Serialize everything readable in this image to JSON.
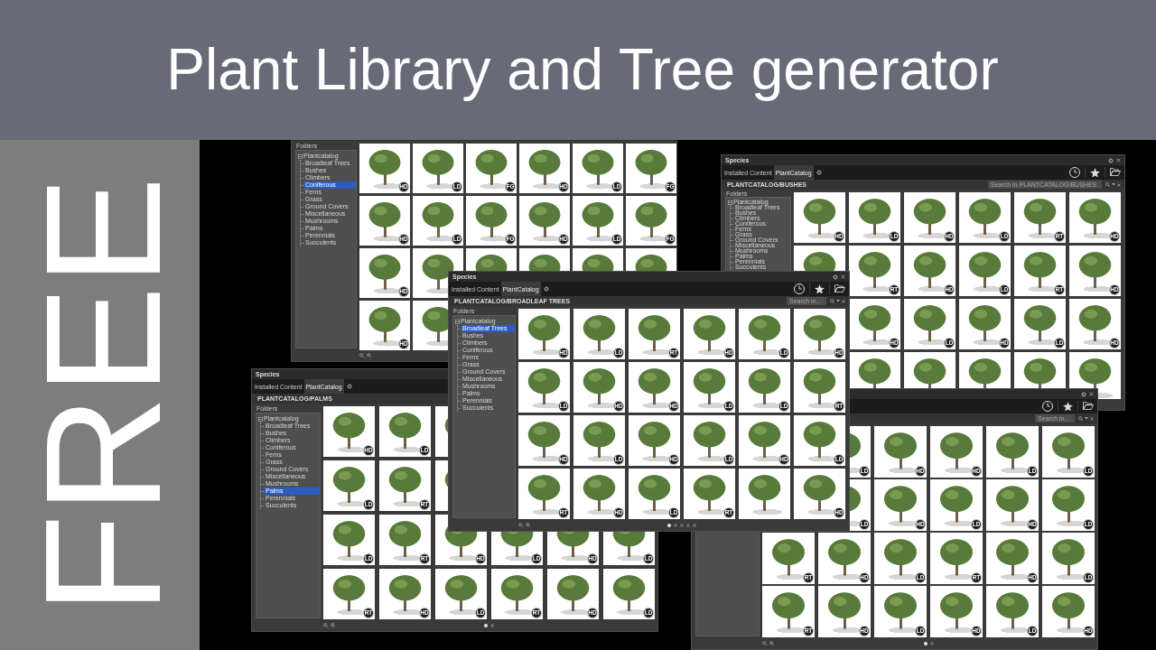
{
  "banner": {
    "title": "Plant Library and Tree generator"
  },
  "side_panel": {
    "text": "FREE"
  },
  "windows": [
    {
      "folders_label": "Folders",
      "folders": [
        {
          "label": "Plantcatalog",
          "expanded": true,
          "selected": false,
          "children": [
            {
              "label": "Broadleaf Trees",
              "selected": false
            },
            {
              "label": "Bushes",
              "selected": false
            },
            {
              "label": "Climbers",
              "selected": false
            },
            {
              "label": "Coniferous",
              "selected": true
            },
            {
              "label": "Ferns",
              "selected": false
            },
            {
              "label": "Grass",
              "selected": false
            },
            {
              "label": "Ground Covers",
              "selected": false
            },
            {
              "label": "Miscellaneous",
              "selected": false
            },
            {
              "label": "Mushrooms",
              "selected": false
            },
            {
              "label": "Palms",
              "selected": false
            },
            {
              "label": "Perennials",
              "selected": false
            },
            {
              "label": "Succulents",
              "selected": false
            }
          ]
        }
      ],
      "rows": [
        {
          "tiles": [
            {
              "selected": false,
              "badge": "HD"
            },
            {
              "selected": false,
              "badge": "LD"
            },
            {
              "selected": false,
              "badge": "FG"
            },
            {
              "selected": false,
              "badge": "HD"
            },
            {
              "selected": false,
              "badge": "LD"
            },
            {
              "selected": false,
              "badge": "FG"
            }
          ]
        },
        {
          "tiles": [
            {
              "selected": false,
              "badge": "HD"
            },
            {
              "selected": false,
              "badge": "LD"
            },
            {
              "selected": false,
              "badge": "FG"
            },
            {
              "selected": false,
              "badge": "HD"
            },
            {
              "selected": false,
              "badge": "LD"
            },
            {
              "selected": false,
              "badge": "FG"
            }
          ]
        },
        {
          "tiles": [
            {
              "selected": false,
              "badge": "HD"
            },
            {
              "selected": false
            },
            {
              "selected": false
            },
            {
              "selected": false
            },
            {
              "selected": false
            },
            {
              "selected": false
            }
          ]
        },
        {
          "tiles": [
            {
              "selected": false,
              "badge": "HD"
            },
            {
              "selected": false
            }
          ]
        }
      ],
      "zoom_buttons": true
    },
    {
      "title": "Species",
      "window_buttons": true,
      "tabs": [
        {
          "label": "Installed Content",
          "selected": false
        },
        {
          "label": "PlantCatalog",
          "selected": true
        }
      ],
      "library_tools": true,
      "path": "PLANTCATALOG/BUSHES",
      "search": {
        "placeholder": "Search in PLANTCATALOG/BUSHES"
      },
      "folders_label": "Folders",
      "folders": [
        {
          "label": "Plantcatalog",
          "expanded": true,
          "selected": false,
          "children": [
            {
              "label": "Broadleaf Trees",
              "selected": false
            },
            {
              "label": "Bushes",
              "selected": false
            },
            {
              "label": "Climbers",
              "selected": false
            },
            {
              "label": "Coniferous",
              "selected": false
            },
            {
              "label": "Ferns",
              "selected": false
            },
            {
              "label": "Grass",
              "selected": false
            },
            {
              "label": "Ground Covers",
              "selected": false
            },
            {
              "label": "Miscellaneous",
              "selected": false
            },
            {
              "label": "Mushrooms",
              "selected": false
            },
            {
              "label": "Palms",
              "selected": false
            },
            {
              "label": "Perennials",
              "selected": false
            },
            {
              "label": "Succulents",
              "selected": false
            }
          ]
        }
      ],
      "rows": [
        {
          "tiles": [
            {
              "selected": false,
              "badge": "HD"
            },
            {
              "selected": false,
              "badge": "LD"
            },
            {
              "selected": false,
              "badge": "HD"
            },
            {
              "selected": false,
              "badge": "LD"
            },
            {
              "selected": false,
              "badge": "RT"
            },
            {
              "selected": false,
              "badge": "HD"
            }
          ]
        },
        {
          "tiles": [
            {
              "selected": false
            },
            {
              "selected": false,
              "badge": "RT"
            },
            {
              "selected": false,
              "badge": "HD"
            },
            {
              "selected": false,
              "badge": "LD"
            },
            {
              "selected": false,
              "badge": "RT"
            },
            {
              "selected": false,
              "badge": "HD"
            }
          ]
        },
        {
          "tiles": [
            {
              "selected": false,
              "badge": "HD"
            },
            {
              "selected": false,
              "badge": "LD"
            },
            {
              "selected": false,
              "badge": "HD"
            },
            {
              "selected": false,
              "badge": "LD"
            },
            {
              "selected": false,
              "badge": "HD"
            }
          ]
        },
        {
          "tiles": [
            {
              "selected": false
            },
            {
              "selected": false
            },
            {
              "selected": false
            },
            {
              "selected": false
            },
            {
              "selected": false
            }
          ]
        }
      ]
    },
    {
      "title": "Species",
      "window_buttons": true,
      "tabs": [
        {
          "label": "Installed Content",
          "selected": false
        },
        {
          "label": "PlantCatalog",
          "selected": true
        }
      ],
      "library_tools": true,
      "path": "PLANTCATALOG/BROADLEAF TREES",
      "search": {
        "placeholder": "Search in..."
      },
      "folders_label": "Folders",
      "folders": [
        {
          "label": "Plantcatalog",
          "expanded": true,
          "selected": false,
          "children": [
            {
              "label": "Broadleaf Trees",
              "selected": true
            },
            {
              "label": "Bushes",
              "selected": false
            },
            {
              "label": "Climbers",
              "selected": false
            },
            {
              "label": "Coniferous",
              "selected": false
            },
            {
              "label": "Ferns",
              "selected": false
            },
            {
              "label": "Grass",
              "selected": false
            },
            {
              "label": "Ground Covers",
              "selected": false
            },
            {
              "label": "Miscellaneous",
              "selected": false
            },
            {
              "label": "Mushrooms",
              "selected": false
            },
            {
              "label": "Palms",
              "selected": false
            },
            {
              "label": "Perennials",
              "selected": false
            },
            {
              "label": "Succulents",
              "selected": false
            }
          ]
        }
      ],
      "rows": [
        {
          "tiles": [
            {
              "selected": false,
              "badge": "HD"
            },
            {
              "selected": false,
              "badge": "LD"
            },
            {
              "selected": false,
              "badge": "RT"
            },
            {
              "selected": false,
              "badge": "HD"
            },
            {
              "selected": false,
              "badge": "LD"
            },
            {
              "selected": false,
              "badge": "HD"
            }
          ]
        },
        {
          "tiles": [
            {
              "selected": false,
              "badge": "LD"
            },
            {
              "selected": false,
              "badge": "HD"
            },
            {
              "selected": false,
              "badge": "HD"
            },
            {
              "selected": false,
              "badge": "LD"
            },
            {
              "selected": false,
              "badge": "LD"
            },
            {
              "selected": false,
              "badge": "RT"
            }
          ]
        },
        {
          "tiles": [
            {
              "selected": false,
              "badge": "HD"
            },
            {
              "selected": false,
              "badge": "LD"
            },
            {
              "selected": false,
              "badge": "HD"
            },
            {
              "selected": false,
              "badge": "LD"
            },
            {
              "selected": false,
              "badge": "HD"
            },
            {
              "selected": false,
              "badge": "LD"
            }
          ]
        },
        {
          "tiles": [
            {
              "selected": false,
              "badge": "RT"
            },
            {
              "selected": false,
              "badge": "HD"
            },
            {
              "selected": false,
              "badge": "LD"
            },
            {
              "selected": false,
              "badge": "RT"
            },
            {
              "selected": false
            },
            {
              "selected": false,
              "badge": "HD"
            }
          ]
        }
      ],
      "zoom_buttons": true,
      "pages": [
        {
          "selected": true
        },
        {
          "selected": false
        },
        {
          "selected": false
        },
        {
          "selected": false
        },
        {
          "selected": false
        }
      ]
    },
    {
      "title": "Species",
      "tabs": [
        {
          "label": "Installed Content",
          "selected": false
        },
        {
          "label": "PlantCatalog",
          "selected": true
        }
      ],
      "path": "PLANTCATALOG/PALMS",
      "folders_label": "Folders",
      "folders": [
        {
          "label": "Plantcatalog",
          "expanded": true,
          "selected": false,
          "children": [
            {
              "label": "Broadleaf Trees",
              "selected": false
            },
            {
              "label": "Bushes",
              "selected": false
            },
            {
              "label": "Climbers",
              "selected": false
            },
            {
              "label": "Coniferous",
              "selected": false
            },
            {
              "label": "Ferns",
              "selected": false
            },
            {
              "label": "Grass",
              "selected": false
            },
            {
              "label": "Ground Covers",
              "selected": false
            },
            {
              "label": "Miscellaneous",
              "selected": false
            },
            {
              "label": "Mushrooms",
              "selected": false
            },
            {
              "label": "Palms",
              "selected": true
            },
            {
              "label": "Perennials",
              "selected": false
            },
            {
              "label": "Succulents",
              "selected": false
            }
          ]
        }
      ],
      "rows": [
        {
          "tiles": [
            {
              "selected": false,
              "badge": "HD"
            },
            {
              "selected": false,
              "badge": "LD"
            },
            {
              "selected": false
            }
          ]
        },
        {
          "tiles": [
            {
              "selected": false,
              "badge": "LD"
            },
            {
              "selected": false,
              "badge": "RT"
            },
            {
              "selected": false
            }
          ]
        },
        {
          "tiles": [
            {
              "selected": false,
              "badge": "LD"
            },
            {
              "selected": false,
              "badge": "RT"
            },
            {
              "selected": false,
              "badge": "HD"
            },
            {
              "selected": false,
              "badge": "LD"
            },
            {
              "selected": false,
              "badge": "HD"
            },
            {
              "selected": false,
              "badge": "LD"
            }
          ]
        },
        {
          "tiles": [
            {
              "selected": false,
              "badge": "RT"
            },
            {
              "selected": false,
              "badge": "HD"
            },
            {
              "selected": false,
              "badge": "LD"
            },
            {
              "selected": false,
              "badge": "RT"
            },
            {
              "selected": false,
              "badge": "HD"
            },
            {
              "selected": false,
              "badge": "LD"
            }
          ]
        }
      ],
      "zoom_buttons": true,
      "pages": [
        {
          "selected": true
        },
        {
          "selected": false
        }
      ]
    },
    {
      "window_buttons": true,
      "library_tools": true,
      "search": {
        "placeholder": "Search in..."
      },
      "rows": [
        {
          "tiles": [
            {
              "selected": false,
              "badge": "LD"
            },
            {
              "selected": false,
              "badge": "HD"
            },
            {
              "selected": false,
              "badge": "HD"
            },
            {
              "selected": false,
              "badge": "LD"
            },
            {
              "selected": false,
              "badge": "LD"
            }
          ]
        },
        {
          "tiles": [
            {
              "selected": false,
              "badge": "LD"
            },
            {
              "selected": false,
              "badge": "HD"
            },
            {
              "selected": false,
              "badge": "LD"
            },
            {
              "selected": false,
              "badge": "HD"
            },
            {
              "selected": false,
              "badge": "LD"
            }
          ]
        },
        {
          "tiles": [
            {
              "selected": false,
              "badge": "RT"
            },
            {
              "selected": false,
              "badge": "HD"
            },
            {
              "selected": false,
              "badge": "LD"
            },
            {
              "selected": false,
              "badge": "RT"
            },
            {
              "selected": false,
              "badge": "HD"
            },
            {
              "selected": false,
              "badge": "LD"
            }
          ]
        },
        {
          "tiles": [
            {
              "selected": false,
              "badge": "RT"
            },
            {
              "selected": false,
              "badge": "HD"
            },
            {
              "selected": false,
              "badge": "LD"
            },
            {
              "selected": false,
              "badge": "HD"
            },
            {
              "selected": false,
              "badge": "LD"
            },
            {
              "selected": false,
              "badge": "HD"
            }
          ]
        }
      ],
      "zoom_buttons": true,
      "pages": [
        {
          "selected": true
        },
        {
          "selected": false
        }
      ]
    }
  ]
}
